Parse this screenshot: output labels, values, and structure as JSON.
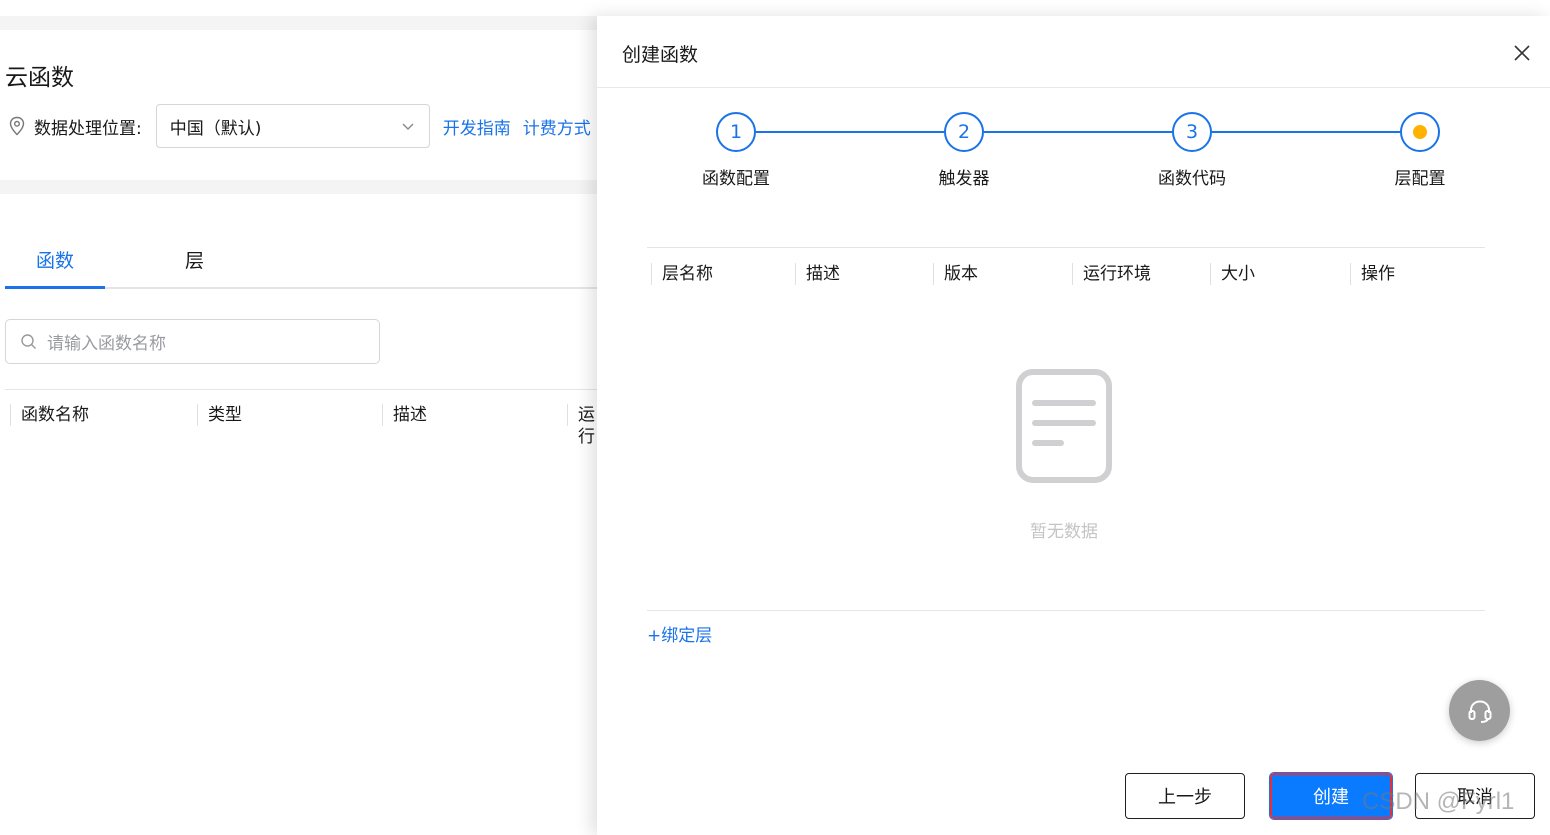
{
  "background_page": {
    "title": "云函数",
    "region_label": "数据处理位置:",
    "region_value": "中国（默认)",
    "links": [
      "开发指南",
      "计费方式"
    ],
    "tabs": [
      "函数",
      "层"
    ],
    "search_placeholder": "请输入函数名称",
    "table_headers": [
      "函数名称",
      "类型",
      "描述",
      "运行"
    ]
  },
  "drawer": {
    "title": "创建函数",
    "steps": [
      {
        "number": "1",
        "label": "函数配置"
      },
      {
        "number": "2",
        "label": "触发器"
      },
      {
        "number": "3",
        "label": "函数代码"
      },
      {
        "number": "",
        "label": "层配置"
      }
    ],
    "layer_table_headers": [
      "层名称",
      "描述",
      "版本",
      "运行环境",
      "大小",
      "操作"
    ],
    "empty_text": "暂无数据",
    "bind_layer": "+绑定层",
    "buttons": {
      "prev": "上一步",
      "create": "创建",
      "cancel": "取消"
    }
  },
  "colors": {
    "accent": "#1a73e8",
    "current_step": "#ffb300",
    "create_button": "#0a7aff",
    "highlight_border": "#e0323c"
  },
  "watermark": "CSDN @Fyrl1"
}
